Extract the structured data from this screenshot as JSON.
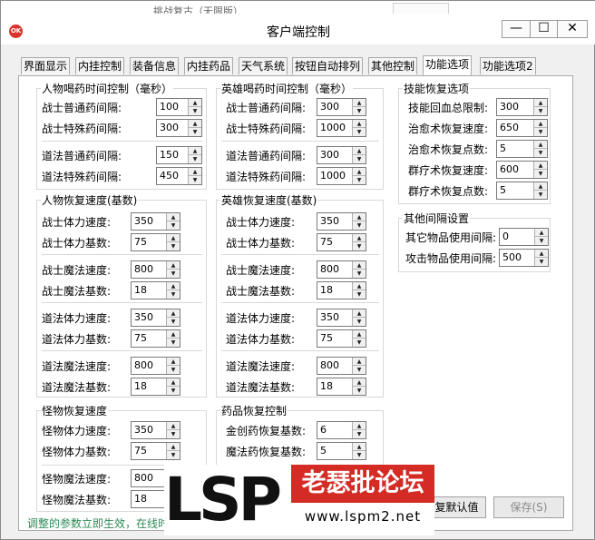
{
  "bg_window_title": "挑战复古（无限版）",
  "window": {
    "title": "客户端控制",
    "icon_text": "OK",
    "min": "—",
    "max": "☐",
    "close": "✕"
  },
  "tabs": [
    {
      "label": "界面显示",
      "active": false
    },
    {
      "label": "内挂控制",
      "active": false
    },
    {
      "label": "装备信息",
      "active": false
    },
    {
      "label": "内挂药品",
      "active": false
    },
    {
      "label": "天气系统",
      "active": false
    },
    {
      "label": "按钮自动排列",
      "active": false
    },
    {
      "label": "其他控制",
      "active": false
    },
    {
      "label": "功能选项",
      "active": true
    },
    {
      "label": "功能选项2",
      "active": false
    }
  ],
  "groups": {
    "person_potion": {
      "title": "人物喝药时间控制（毫秒）",
      "rows": [
        {
          "label": "战士普通药间隔:",
          "value": "100"
        },
        {
          "label": "战士特殊药间隔:",
          "value": "300"
        },
        {
          "label": "道法普通药间隔:",
          "value": "150"
        },
        {
          "label": "道法特殊药间隔:",
          "value": "450"
        }
      ]
    },
    "hero_potion": {
      "title": "英雄喝药时间控制（毫秒）",
      "rows": [
        {
          "label": "战士普通药间隔:",
          "value": "300"
        },
        {
          "label": "战士特殊药间隔:",
          "value": "1000"
        },
        {
          "label": "道法普通药间隔:",
          "value": "300"
        },
        {
          "label": "道法特殊药间隔:",
          "value": "1000"
        }
      ]
    },
    "skill_recover": {
      "title": "技能恢复选项",
      "rows": [
        {
          "label": "技能回血总限制:",
          "value": "300"
        },
        {
          "label": "治愈术恢复速度:",
          "value": "650"
        },
        {
          "label": "治愈术恢复点数:",
          "value": "5"
        },
        {
          "label": "群疗术恢复速度:",
          "value": "600"
        },
        {
          "label": "群疗术恢复点数:",
          "value": "5"
        }
      ]
    },
    "other_interval": {
      "title": "其他间隔设置",
      "rows": [
        {
          "label": "其它物品使用间隔:",
          "value": "0"
        },
        {
          "label": "攻击物品使用间隔:",
          "value": "500"
        }
      ]
    },
    "person_recover": {
      "title": "人物恢复速度(基数)",
      "rows": [
        {
          "label": "战士体力速度:",
          "value": "350"
        },
        {
          "label": "战士体力基数:",
          "value": "75"
        },
        {
          "label": "战士魔法速度:",
          "value": "800"
        },
        {
          "label": "战士魔法基数:",
          "value": "18"
        },
        {
          "label": "道法体力速度:",
          "value": "350"
        },
        {
          "label": "道法体力基数:",
          "value": "75"
        },
        {
          "label": "道法魔法速度:",
          "value": "800"
        },
        {
          "label": "道法魔法基数:",
          "value": "18"
        }
      ]
    },
    "hero_recover": {
      "title": "英雄恢复速度(基数)",
      "rows": [
        {
          "label": "战士体力速度:",
          "value": "350"
        },
        {
          "label": "战士体力基数:",
          "value": "75"
        },
        {
          "label": "战士魔法速度:",
          "value": "800"
        },
        {
          "label": "战士魔法基数:",
          "value": "18"
        },
        {
          "label": "道法体力速度:",
          "value": "350"
        },
        {
          "label": "道法体力基数:",
          "value": "75"
        },
        {
          "label": "道法魔法速度:",
          "value": "800"
        },
        {
          "label": "道法魔法基数:",
          "value": "18"
        }
      ]
    },
    "monster_recover": {
      "title": "怪物恢复速度",
      "rows": [
        {
          "label": "怪物体力速度:",
          "value": "350"
        },
        {
          "label": "怪物体力基数:",
          "value": "75"
        },
        {
          "label": "怪物魔法速度:",
          "value": "800"
        },
        {
          "label": "怪物魔法基数:",
          "value": "18"
        }
      ]
    },
    "potion_recover": {
      "title": "药品恢复控制",
      "rows": [
        {
          "label": "金创药恢复基数:",
          "value": "6"
        },
        {
          "label": "魔法药恢复基数:",
          "value": "5"
        }
      ]
    }
  },
  "status_text": "调整的参数立即生效，在线时",
  "buttons": {
    "default": "复默认值",
    "save": "保存(S)"
  },
  "watermark": {
    "big": "LSP",
    "cn": "老瑟批论坛",
    "url": "www.lspm2.net"
  },
  "colors": {
    "status": "#2e8b57",
    "watermark_red": "#d42b24"
  }
}
